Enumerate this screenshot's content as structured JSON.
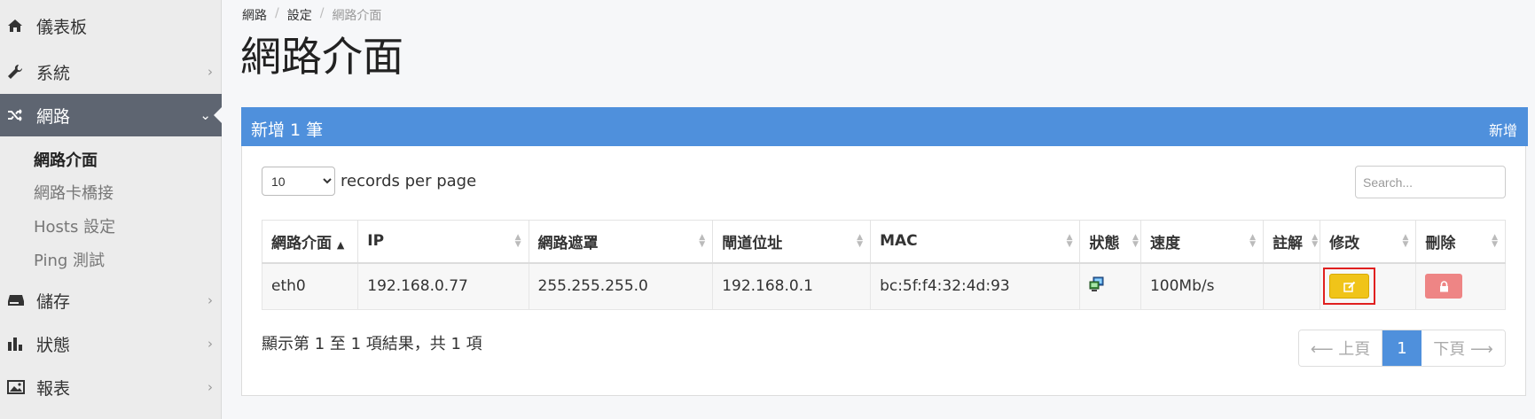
{
  "sidebar": {
    "items": [
      {
        "label": "儀表板",
        "icon": "home-icon"
      },
      {
        "label": "系統",
        "icon": "wrench-icon"
      },
      {
        "label": "網路",
        "icon": "shuffle-icon"
      },
      {
        "label": "儲存",
        "icon": "drive-icon"
      },
      {
        "label": "狀態",
        "icon": "bar-chart-icon"
      },
      {
        "label": "報表",
        "icon": "image-icon"
      }
    ],
    "network_sub": [
      "網路介面",
      "網路卡橋接",
      "Hosts 設定",
      "Ping 測試"
    ]
  },
  "breadcrumb": [
    "網路",
    "設定",
    "網路介面"
  ],
  "page_title": "網路介面",
  "panel": {
    "title": "新增 1 筆",
    "add_label": "新增"
  },
  "table_controls": {
    "per_page_value": "10",
    "per_page_text": "records per page",
    "search_placeholder": "Search..."
  },
  "table": {
    "headers": [
      "網路介面",
      "IP",
      "網路遮罩",
      "閘道位址",
      "MAC",
      "狀態",
      "速度",
      "註解",
      "修改",
      "刪除"
    ],
    "rows": [
      {
        "iface": "eth0",
        "ip": "192.168.0.77",
        "mask": "255.255.255.0",
        "gateway": "192.168.0.1",
        "mac": "bc:5f:f4:32:4d:93",
        "status_icon": "network-connected-icon",
        "speed": "100Mb/s",
        "note": ""
      }
    ]
  },
  "footer": {
    "result_info": "顯示第 1 至 1 項結果，共 1 項",
    "prev_label": "⟵ 上頁",
    "page": "1",
    "next_label": "下頁 ⟶"
  },
  "colors": {
    "header_blue": "#4f90dc",
    "active_nav": "#5e6571",
    "edit_yellow": "#f0c419",
    "delete_red": "#ee8585"
  }
}
